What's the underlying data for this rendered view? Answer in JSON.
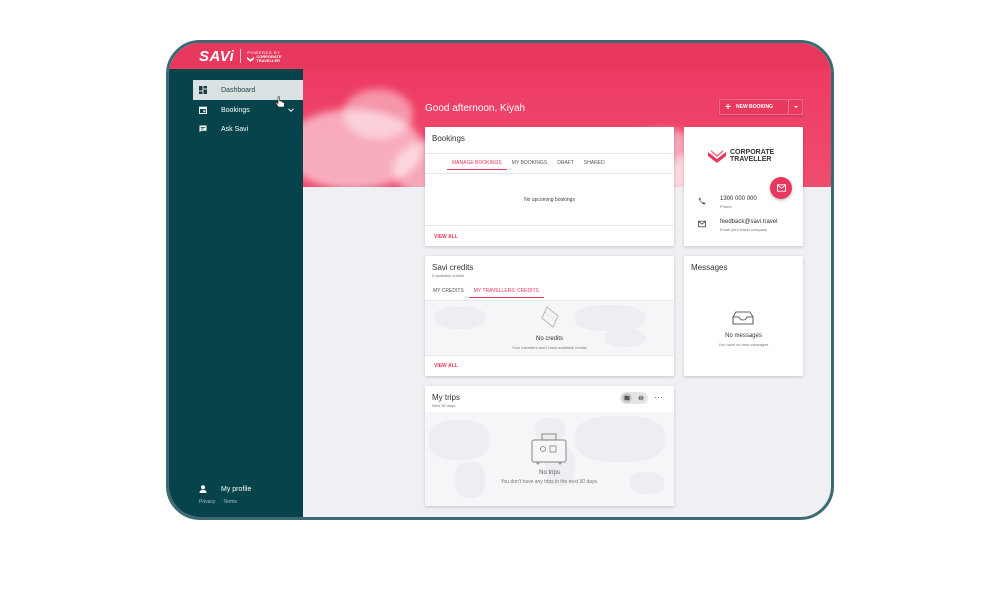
{
  "header": {
    "brand": "SAVi",
    "powered_by": "POWERED BY",
    "partner_line1": "CORPORATE",
    "partner_line2": "TRAVELLER"
  },
  "sidebar": {
    "items": [
      {
        "label": "Dashboard",
        "icon": "dashboard-icon",
        "active": true
      },
      {
        "label": "Bookings",
        "icon": "calendar-icon",
        "expandable": true
      },
      {
        "label": "Ask Savi",
        "icon": "chat-icon"
      }
    ],
    "profile_label": "My profile",
    "footer_links": [
      "Privacy",
      "Terms"
    ]
  },
  "main": {
    "greeting": "Good afternoon, Kiyah",
    "new_booking_label": "NEW BOOKING",
    "bookings_card": {
      "title": "Bookings",
      "tabs": [
        "MANAGE BOOKINGS",
        "MY BOOKINGS",
        "DRAFT",
        "SHARED"
      ],
      "active_tab": 0,
      "empty_text": "No upcoming bookings",
      "view_all": "VIEW ALL"
    },
    "contact_card": {
      "logo_line1": "CORPORATE",
      "logo_line2": "TRAVELLER",
      "phone": "1300 000 000",
      "phone_label": "Phone",
      "email": "feedback@savi.travel",
      "email_label": "Email your travel company"
    },
    "credits_card": {
      "title": "Savi credits",
      "subtitle": "0 available credits",
      "tabs": [
        "MY CREDITS",
        "MY TRAVELLERS' CREDITS"
      ],
      "active_tab": 1,
      "empty_title": "No credits",
      "empty_text": "Your travellers don't have available credits",
      "view_all": "VIEW ALL"
    },
    "messages_card": {
      "title": "Messages",
      "empty_title": "No messages",
      "empty_text": "You have no new messages"
    },
    "trips_card": {
      "title": "My trips",
      "subtitle": "Next 30 days",
      "empty_title": "No trips",
      "empty_text": "You don't have any trips in the next 30 days."
    }
  },
  "colors": {
    "brand": "#e8385e",
    "sidebar": "#07434a",
    "frame": "#3b6b70"
  }
}
